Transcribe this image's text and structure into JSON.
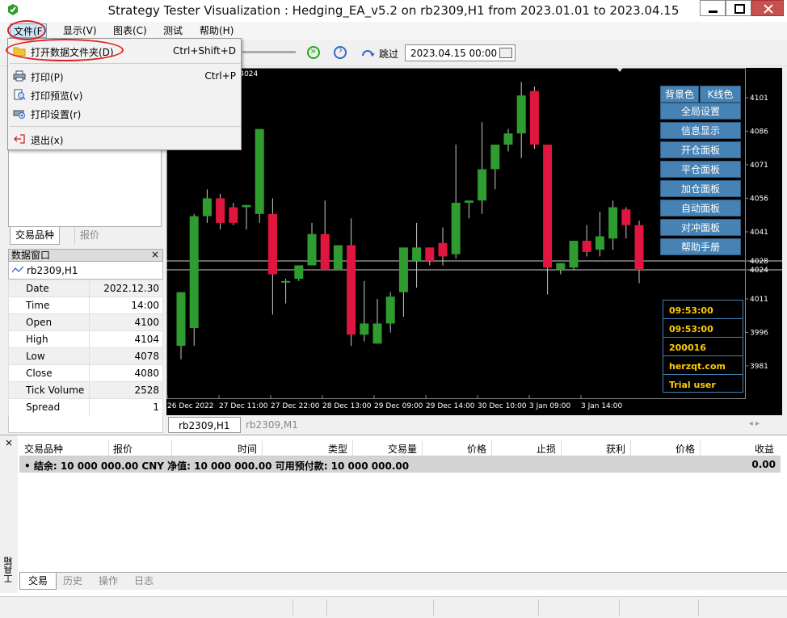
{
  "window": {
    "title": "Strategy Tester Visualization : Hedging_EA_v5.2 on rb2309,H1 from 2023.01.01 to 2023.04.15"
  },
  "menubar": {
    "items": [
      {
        "label": "文件(F",
        "active": true
      },
      {
        "label": "显示(V)"
      },
      {
        "label": "图表(C)"
      },
      {
        "label": "测试"
      },
      {
        "label": "帮助(H)"
      }
    ]
  },
  "file_menu": {
    "items": [
      {
        "label": "打开数据文件夹(D)",
        "shortcut": "Ctrl+Shift+D",
        "icon": "folder-icon"
      },
      {
        "label": "打印(P)",
        "shortcut": "Ctrl+P",
        "icon": "printer-icon"
      },
      {
        "label": "打印预览(v)",
        "shortcut": "",
        "icon": "print-preview-icon"
      },
      {
        "label": "打印设置(r)",
        "shortcut": "",
        "icon": "print-setup-icon"
      },
      {
        "label": "退出(x)",
        "shortcut": "",
        "icon": "exit-icon"
      }
    ]
  },
  "toolbar": {
    "skip_label": "跳过",
    "date_value": "2023.04.15 00:00"
  },
  "left_panel": {
    "tabs": [
      "交易品种",
      "报价"
    ]
  },
  "data_window": {
    "title": "数据窗口",
    "close": "×",
    "symbol": "rb2309,H1",
    "rows": [
      {
        "key": "Date",
        "value": "2022.12.30"
      },
      {
        "key": "Time",
        "value": "14:00"
      },
      {
        "key": "Open",
        "value": "4100"
      },
      {
        "key": "High",
        "value": "4104"
      },
      {
        "key": "Low",
        "value": "4078"
      },
      {
        "key": "Close",
        "value": "4080"
      },
      {
        "key": "Tick Volume",
        "value": "2528"
      },
      {
        "key": "Spread",
        "value": "1"
      }
    ]
  },
  "chart": {
    "info_text": "6 4016 4024",
    "panel_buttons": [
      "背景色",
      "K线色",
      "全局设置",
      "信息显示",
      "开仓面板",
      "平仓面板",
      "加仓面板",
      "自动面板",
      "对冲面板",
      "帮助手册"
    ],
    "info_box": [
      "09:53:00",
      "09:53:00",
      "200016",
      "herzqt.com",
      "Trial user"
    ],
    "tabs": [
      "rb2309,H1",
      "rb2309,M1"
    ],
    "price_labels": [
      "4101",
      "4086",
      "4071",
      "4056",
      "4041",
      "4028",
      "4024",
      "4011",
      "3996",
      "3981"
    ],
    "time_labels": [
      "26 Dec 2022",
      "27 Dec 11:00",
      "27 Dec 22:00",
      "28 Dec 13:00",
      "29 Dec 09:00",
      "29 Dec 14:00",
      "30 Dec 10:00",
      "3 Jan 09:00",
      "3 Jan 14:00"
    ]
  },
  "chart_data": {
    "type": "candlestick",
    "ylim": [
      3968,
      4110
    ],
    "hlines": [
      4028,
      4024
    ],
    "colors": {
      "up": "#2e9c2e",
      "down": "#e0163f",
      "wick": "#c8c8c8"
    },
    "candles": [
      {
        "o": 3990,
        "h": 4014,
        "l": 3984,
        "c": 4014
      },
      {
        "o": 3998,
        "h": 4049,
        "l": 3990,
        "c": 4048
      },
      {
        "o": 4048,
        "h": 4060,
        "l": 4045,
        "c": 4056
      },
      {
        "o": 4056,
        "h": 4058,
        "l": 4042,
        "c": 4045
      },
      {
        "o": 4052,
        "h": 4054,
        "l": 4044,
        "c": 4045
      },
      {
        "o": 4052,
        "h": 4053,
        "l": 4042,
        "c": 4053
      },
      {
        "o": 4049,
        "h": 4087,
        "l": 4045,
        "c": 4087
      },
      {
        "o": 4049,
        "h": 4056,
        "l": 4004,
        "c": 4022
      },
      {
        "o": 4019,
        "h": 4020,
        "l": 4009,
        "c": 4019
      },
      {
        "o": 4020,
        "h": 4026,
        "l": 4019,
        "c": 4026
      },
      {
        "o": 4026,
        "h": 4045,
        "l": 4026,
        "c": 4040
      },
      {
        "o": 4040,
        "h": 4055,
        "l": 4024,
        "c": 4024
      },
      {
        "o": 4024,
        "h": 4035,
        "l": 4024,
        "c": 4035
      },
      {
        "o": 4035,
        "h": 4047,
        "l": 3990,
        "c": 3995
      },
      {
        "o": 3995,
        "h": 4019,
        "l": 3992,
        "c": 4000
      },
      {
        "o": 3991,
        "h": 4011,
        "l": 3991,
        "c": 4000
      },
      {
        "o": 4000,
        "h": 4014,
        "l": 3996,
        "c": 4012
      },
      {
        "o": 4014,
        "h": 4030,
        "l": 4003,
        "c": 4034
      },
      {
        "o": 4028,
        "h": 4045,
        "l": 4016,
        "c": 4034
      },
      {
        "o": 4034,
        "h": 4034,
        "l": 4026,
        "c": 4028
      },
      {
        "o": 4036,
        "h": 4043,
        "l": 4026,
        "c": 4030
      },
      {
        "o": 4031,
        "h": 4080,
        "l": 4029,
        "c": 4054
      },
      {
        "o": 4054,
        "h": 4054,
        "l": 4047,
        "c": 4055
      },
      {
        "o": 4055,
        "h": 4090,
        "l": 4049,
        "c": 4069
      },
      {
        "o": 4069,
        "h": 4080,
        "l": 4060,
        "c": 4080
      },
      {
        "o": 4080,
        "h": 4087,
        "l": 4077,
        "c": 4085
      },
      {
        "o": 4085,
        "h": 4108,
        "l": 4074,
        "c": 4102
      },
      {
        "o": 4104,
        "h": 4106,
        "l": 4078,
        "c": 4080
      },
      {
        "o": 4080,
        "h": 4080,
        "l": 4013,
        "c": 4025
      },
      {
        "o": 4024,
        "h": 4027,
        "l": 4022,
        "c": 4027
      },
      {
        "o": 4025,
        "h": 4037,
        "l": 4024,
        "c": 4037
      },
      {
        "o": 4037,
        "h": 4044,
        "l": 4030,
        "c": 4032
      },
      {
        "o": 4033,
        "h": 4050,
        "l": 4030,
        "c": 4039
      },
      {
        "o": 4038,
        "h": 4055,
        "l": 4033,
        "c": 4052
      },
      {
        "o": 4051,
        "h": 4052,
        "l": 4038,
        "c": 4044
      },
      {
        "o": 4044,
        "h": 4046,
        "l": 4018,
        "c": 4024
      }
    ]
  },
  "terminal": {
    "vertical_label": "工具箱",
    "close": "×",
    "columns": [
      "交易品种",
      "报价",
      "时间",
      "类型",
      "交易量",
      "价格",
      "止损",
      "获利",
      "价格",
      "收益"
    ],
    "summary": "•  结余: 10 000 000.00 CNY  净值: 10 000 000.00  可用预付款: 10 000 000.00",
    "summary_value": "0.00",
    "tabs": [
      "交易",
      "历史",
      "操作",
      "日志"
    ]
  }
}
